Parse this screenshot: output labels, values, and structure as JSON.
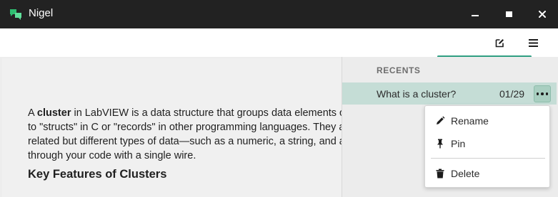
{
  "window": {
    "title": "Nigel",
    "icon": "chat-bubbles-icon",
    "accent_color": "#2fbf71"
  },
  "controls": {
    "minimize": "minimize-icon",
    "maximize": "maximize-icon",
    "close_glyph": "✕"
  },
  "toolbar": {
    "new_chat_icon": "edit-icon",
    "menu_icon": "hamburger-icon"
  },
  "content": {
    "paragraph_lines": [
      [
        "A ",
        "cluster",
        " in LabVIEW is a data structure that groups data elements of mixed t"
      ],
      [
        "to \"structs\" in C or \"records\" in other programming languages. They are use"
      ],
      [
        "related but different types of data—such as a numeric, a string, and a Boolea"
      ],
      [
        "through your code with a single wire."
      ]
    ],
    "heading": "Key Features of Clusters"
  },
  "sidebar": {
    "section_label": "RECENTS",
    "items": [
      {
        "title": "What is a cluster?",
        "date": "01/29",
        "selected": true
      }
    ],
    "selected_bg": "#c5ddd6",
    "accent": "#2f9e82"
  },
  "context_menu": {
    "items": [
      {
        "label": "Rename",
        "icon": "pencil-icon"
      },
      {
        "label": "Pin",
        "icon": "pin-icon"
      },
      {
        "label": "Delete",
        "icon": "trash-icon"
      }
    ]
  }
}
